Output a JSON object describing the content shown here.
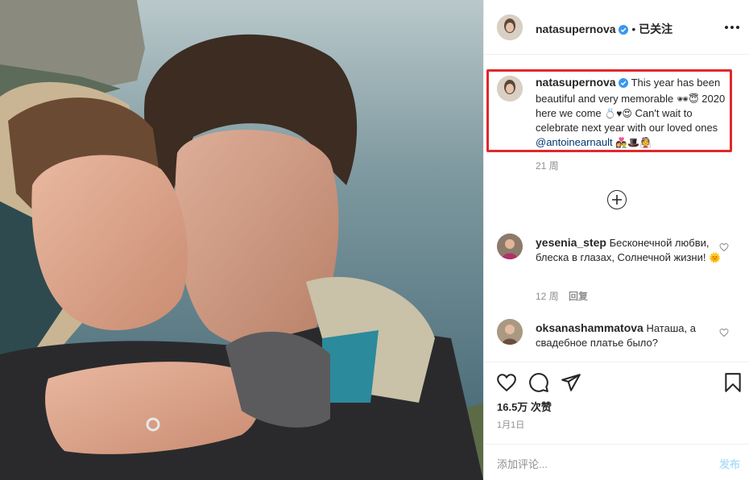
{
  "post": {
    "username": "natasupernova",
    "follow_status": "已关注",
    "separator": "•",
    "caption_text_1": "This year has been beautiful and very memorable",
    "caption_text_2": "2020 here we come",
    "caption_text_3": "Can't wait to celebrate next year with our loved ones",
    "caption_mention": "@antoinearnault",
    "emojis": {
      "e1": "🕶",
      "e2": "😇",
      "e3": "💍",
      "e4": "♥",
      "e5": "😍",
      "e6": "👩‍❤️‍👨",
      "e7": "🎩",
      "e8": "👰",
      "e9": "🌞"
    },
    "caption_time": "21 周"
  },
  "comments": [
    {
      "username": "yesenia_step",
      "text": "Бесконечной любви, блеска в глазах, Солнечной жизни!",
      "time": "12 周",
      "reply": "回复"
    },
    {
      "username": "oksanashammatova",
      "text": "Наташа, а свадебное платье было?"
    }
  ],
  "footer": {
    "likes": "16.5万 次赞",
    "date": "1月1日",
    "comment_placeholder": "添加评论...",
    "post_button": "发布"
  },
  "colors": {
    "accent": "#0095f6",
    "highlight": "#e0282c",
    "verified": "#3897f0"
  }
}
